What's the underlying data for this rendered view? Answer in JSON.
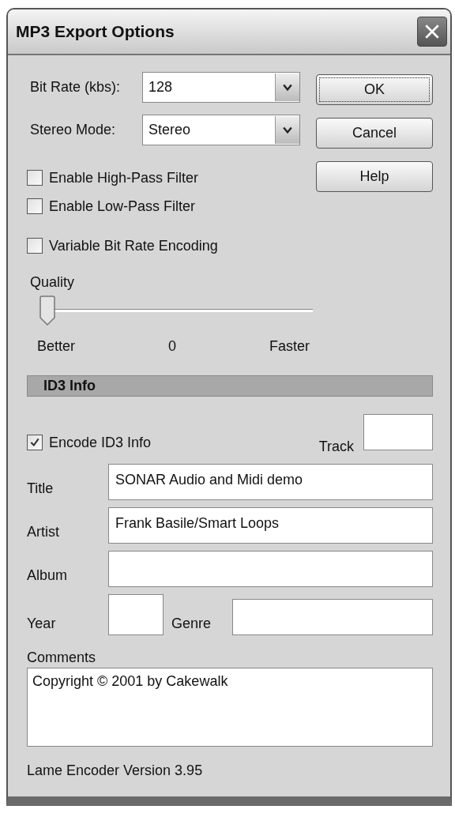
{
  "window": {
    "title": "MP3 Export Options"
  },
  "settings": [
    {
      "kind": "combo",
      "label": "Bit Rate (kbs):",
      "value": "128"
    },
    {
      "kind": "combo",
      "label": "Stereo Mode:",
      "value": "Stereo"
    }
  ],
  "filters": [
    {
      "label": "Enable High-Pass Filter",
      "checked": false
    },
    {
      "label": "Enable Low-Pass Filter",
      "checked": false
    }
  ],
  "vbr": {
    "label": "Variable Bit Rate Encoding",
    "checked": false
  },
  "quality": {
    "label": "Quality",
    "level": 0,
    "min_label": "Better",
    "reading": "0",
    "max_label": "Faster"
  },
  "buttons": [
    {
      "label": "OK",
      "default": true
    },
    {
      "label": "Cancel",
      "default": false
    },
    {
      "label": "Help",
      "default": false
    }
  ],
  "id3": {
    "heading": "ID3 Info",
    "encode": {
      "label": "Encode ID3 Info",
      "checked": true
    },
    "track": {
      "label": "Track"
    },
    "fields": [
      {
        "label": "Title",
        "value": "SONAR Audio and Midi demo"
      },
      {
        "label": "Artist",
        "value": "Frank Basile/Smart Loops"
      },
      {
        "label": "Album"
      }
    ],
    "year": {
      "label": "Year"
    },
    "genre": {
      "label": "Genre"
    },
    "comments": {
      "label": "Comments",
      "value": "Copyright © 2001 by Cakewalk"
    }
  },
  "footer": "Lame Encoder Version 3.95"
}
